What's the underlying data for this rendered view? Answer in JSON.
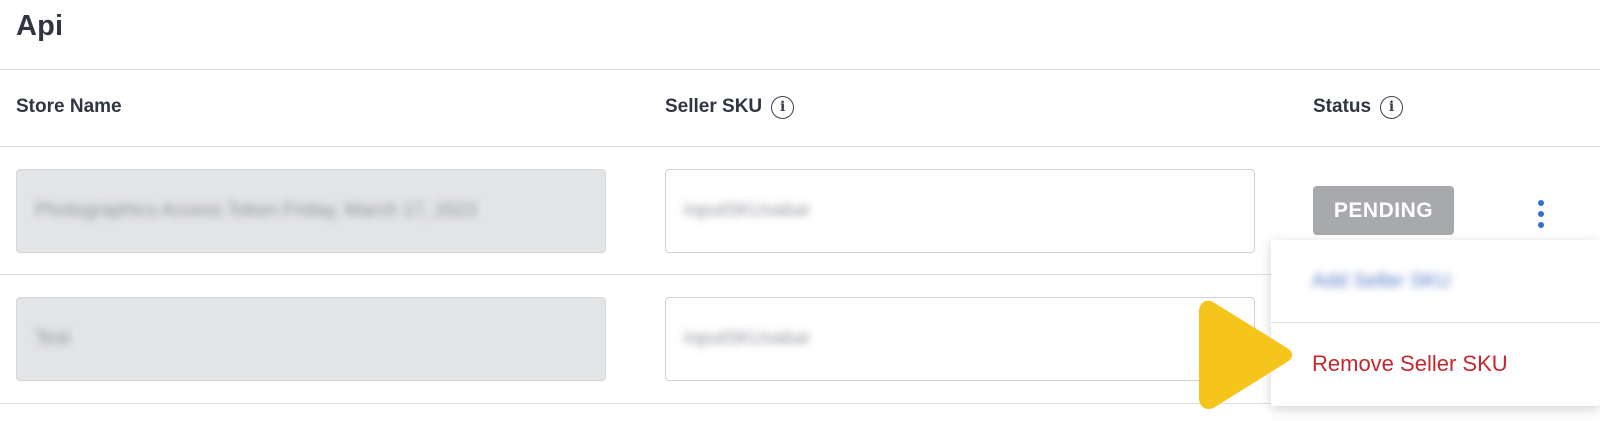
{
  "section": {
    "title": "Api"
  },
  "table": {
    "columns": {
      "store_name": "Store Name",
      "seller_sku": "Seller SKU",
      "status": "Status"
    },
    "rows": [
      {
        "store_name": "Photographics Access Token Friday, March 17, 2023",
        "seller_sku": "inputSKUvalue",
        "status": "PENDING"
      },
      {
        "store_name": "Test",
        "seller_sku": "inputSKUvalue"
      }
    ]
  },
  "row_menu": {
    "items": [
      {
        "label": "Add Seller SKU"
      },
      {
        "label": "Remove Seller SKU"
      }
    ]
  },
  "icons": {
    "info": "info-icon",
    "kebab": "kebab-menu-icon",
    "pointer": "pointer-arrow-icon"
  },
  "colors": {
    "pending_badge": "#a7a9ad",
    "remove_text": "#c4282f",
    "kebab_accent": "#2f6fd6",
    "pointer_arrow": "#f6c51b"
  }
}
